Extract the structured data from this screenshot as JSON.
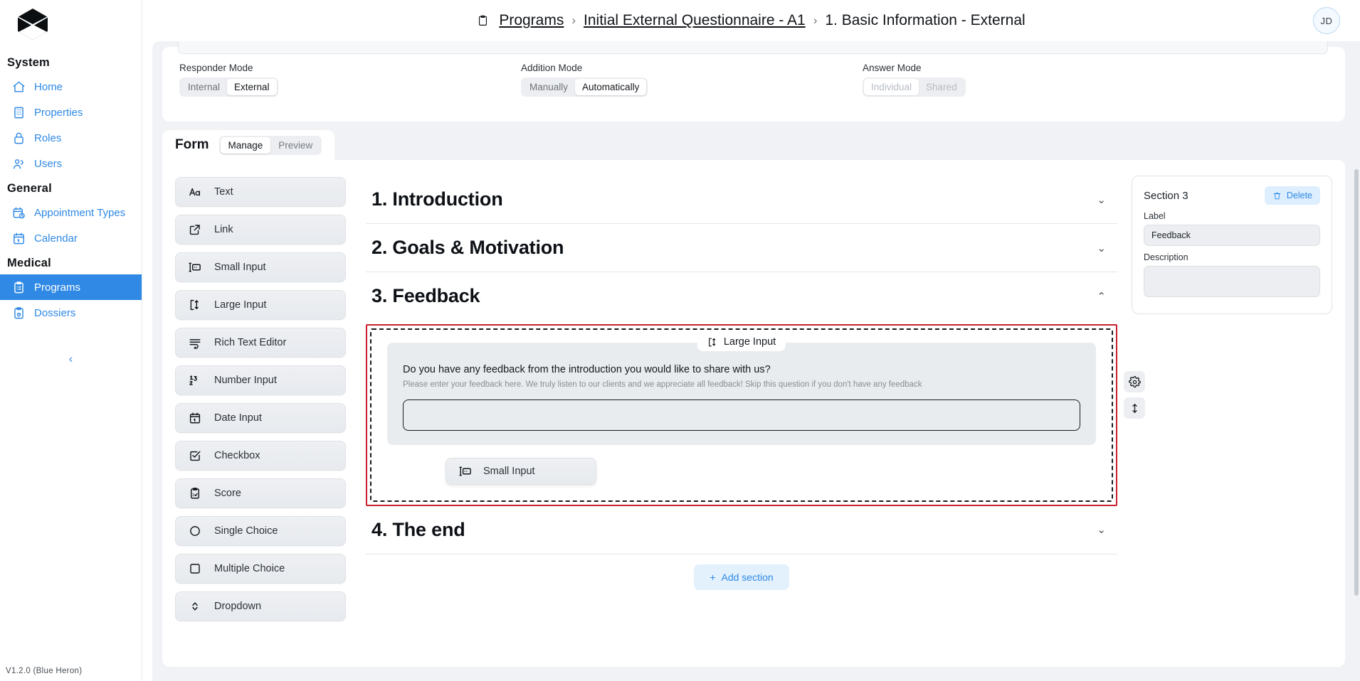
{
  "brand": {
    "logo_icon": "hexagon-logo",
    "accent": "#2f89e5"
  },
  "sidebar": {
    "groups": [
      {
        "title": "System",
        "items": [
          {
            "label": "Home",
            "icon": "home-icon",
            "active": false
          },
          {
            "label": "Properties",
            "icon": "building-icon",
            "active": false
          },
          {
            "label": "Roles",
            "icon": "lock-icon",
            "active": false
          },
          {
            "label": "Users",
            "icon": "users-icon",
            "active": false
          }
        ]
      },
      {
        "title": "General",
        "items": [
          {
            "label": "Appointment Types",
            "icon": "calendar-clock-icon",
            "active": false
          },
          {
            "label": "Calendar",
            "icon": "calendar-icon",
            "active": false
          }
        ]
      },
      {
        "title": "Medical",
        "items": [
          {
            "label": "Programs",
            "icon": "clipboard-list-icon",
            "active": true
          },
          {
            "label": "Dossiers",
            "icon": "clipboard-heart-icon",
            "active": false
          }
        ]
      }
    ],
    "collapse_label": "‹",
    "version": "V1.2.0 (Blue Heron)"
  },
  "topbar": {
    "breadcrumb": {
      "icon": "clipboard-icon",
      "items": [
        "Programs",
        "Initial External Questionnaire - A1",
        "1. Basic Information - External"
      ],
      "separator": "›"
    },
    "avatar_initials": "JD"
  },
  "modes": {
    "responder": {
      "label": "Responder Mode",
      "options": [
        "Internal",
        "External"
      ],
      "selected": "External",
      "disabled": false
    },
    "addition": {
      "label": "Addition Mode",
      "options": [
        "Manually",
        "Automatically"
      ],
      "selected": "Automatically",
      "disabled": false
    },
    "answer": {
      "label": "Answer Mode",
      "options": [
        "Individual",
        "Shared"
      ],
      "selected": "Individual",
      "disabled": true
    }
  },
  "form_header": {
    "title": "Form",
    "tabs": [
      "Manage",
      "Preview"
    ],
    "selected_tab": "Manage"
  },
  "palette": {
    "items": [
      {
        "label": "Text",
        "icon": "text-aa-icon"
      },
      {
        "label": "Link",
        "icon": "external-link-icon"
      },
      {
        "label": "Small Input",
        "icon": "small-input-icon"
      },
      {
        "label": "Large Input",
        "icon": "large-input-icon"
      },
      {
        "label": "Rich Text Editor",
        "icon": "rich-text-icon"
      },
      {
        "label": "Number Input",
        "icon": "number-icon"
      },
      {
        "label": "Date Input",
        "icon": "calendar-icon"
      },
      {
        "label": "Checkbox",
        "icon": "checkbox-checked-icon"
      },
      {
        "label": "Score",
        "icon": "clipboard-check-icon"
      },
      {
        "label": "Single Choice",
        "icon": "circle-icon"
      },
      {
        "label": "Multiple Choice",
        "icon": "square-icon"
      },
      {
        "label": "Dropdown",
        "icon": "chevron-updown-icon"
      }
    ]
  },
  "canvas": {
    "sections": [
      {
        "title": "1. Introduction",
        "chevron": "⌄",
        "expanded": false
      },
      {
        "title": "2. Goals & Motivation",
        "chevron": "⌄",
        "expanded": false
      },
      {
        "title": "3. Feedback",
        "chevron": "⌃",
        "expanded": true
      },
      {
        "title": "4. The end",
        "chevron": "⌄",
        "expanded": false
      }
    ],
    "active_field": {
      "badge_label": "Large Input",
      "badge_icon": "large-input-icon",
      "question": "Do you have any feedback from the introduction you would like to share with us?",
      "help_text": "Please enter your feedback here. We truly listen to our clients and we appreciate all feedback! Skip this question if you don't have any feedback",
      "input_value": "",
      "tools": [
        {
          "name": "settings",
          "icon": "gear-icon"
        },
        {
          "name": "move",
          "icon": "move-vertical-icon"
        }
      ]
    },
    "drag_chip": {
      "label": "Small Input",
      "icon": "small-input-icon"
    },
    "add_section_button": {
      "label": "Add section",
      "plus": "+"
    }
  },
  "inspector": {
    "title": "Section 3",
    "delete_button": {
      "label": "Delete",
      "icon": "trash-icon"
    },
    "label_caption": "Label",
    "label_value": "Feedback",
    "description_caption": "Description",
    "description_value": "",
    "description_placeholder": ""
  }
}
